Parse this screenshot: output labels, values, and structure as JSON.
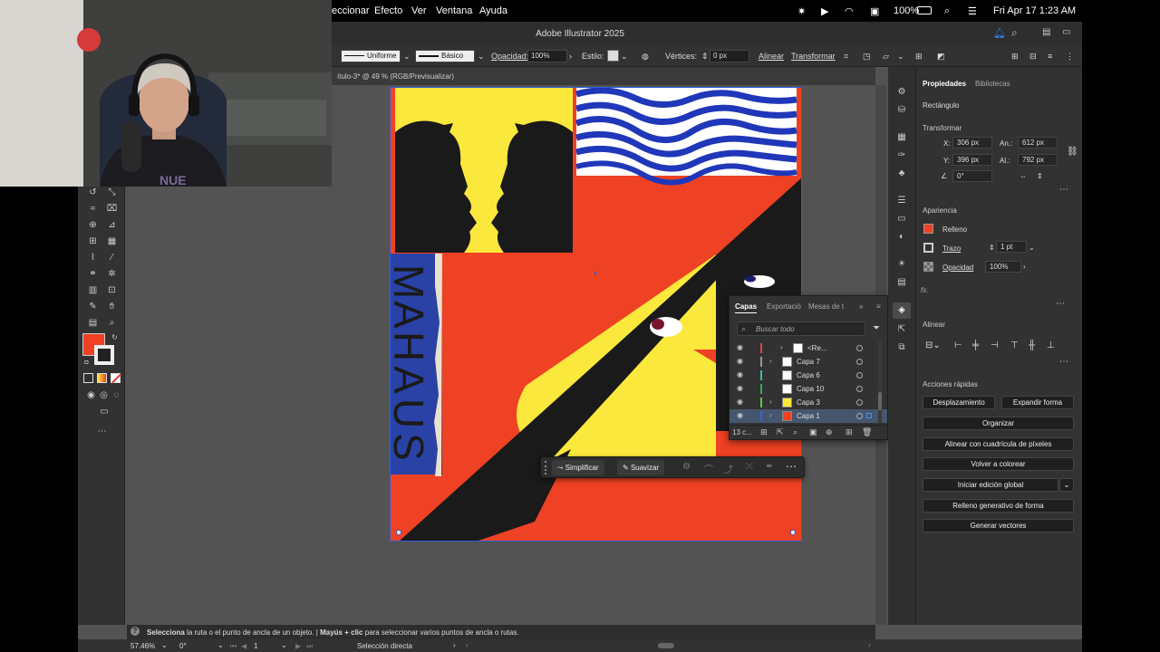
{
  "menubar": {
    "items": [
      "eccionar",
      "Efecto",
      "Ver",
      "Ventana",
      "Ayuda"
    ],
    "battery": "100%",
    "datetime": "Fri Apr 17  1:23 AM"
  },
  "window": {
    "title": "Adobe Illustrator 2025"
  },
  "control_bar": {
    "stroke_style": "Uniforme",
    "brush": "Básico",
    "opacity_label": "Opacidad:",
    "opacity_value": "100%",
    "style_label": "Estilo:",
    "vertices_label": "Vértices:",
    "vertices_value": "0 px",
    "align": "Alinear",
    "transform": "Transformar"
  },
  "doc_tab": {
    "title": "ítulo-3* @ 49 % (RGB/Previsualizar)"
  },
  "fill_color": "#f04124",
  "artwork": {
    "letters": [
      "M",
      "A",
      "H",
      "A",
      "U",
      "S"
    ],
    "colors": {
      "red": "#ef4123",
      "yellow": "#fbe83c",
      "blue": "#2a42a6",
      "black": "#1a1a1a"
    }
  },
  "layers_panel": {
    "tabs": [
      "Capas",
      "Exportació",
      "Mesas de t"
    ],
    "search_placeholder": "Buscar todo",
    "rows": [
      {
        "name": "<Re...",
        "color": "#e84040",
        "thumb": "#ffffff"
      },
      {
        "name": "Capa 7",
        "color": "#999999",
        "thumb": "#ffffff"
      },
      {
        "name": "Capa 6",
        "color": "#33bbaa",
        "thumb": "#ffffff"
      },
      {
        "name": "Capa 10",
        "color": "#33aa55",
        "thumb": "#ffffff"
      },
      {
        "name": "Capa 3",
        "color": "#55cc44",
        "thumb": "#fbe83c"
      },
      {
        "name": "Capa 1",
        "color": "#3366dd",
        "thumb": "#ef4123"
      }
    ],
    "count": "13 c..."
  },
  "float_toolbar": {
    "simplify": "Simplificar",
    "smooth": "Suavizar"
  },
  "properties": {
    "tabs": [
      "Propiedades",
      "Bibliotecas"
    ],
    "object_type": "Rectángulo",
    "transform_heading": "Transformar",
    "x_label": "X:",
    "x_value": "306 px",
    "y_label": "Y:",
    "y_value": "396 px",
    "w_label": "An.:",
    "w_value": "612 px",
    "h_label": "Al.:",
    "h_value": "792 px",
    "angle": "0°",
    "appearance_heading": "Apariencia",
    "fill_label": "Relleno",
    "stroke_label": "Trazo",
    "stroke_value": "1 pt",
    "opacity_label": "Opacidad",
    "opacity_value": "100%",
    "fx": "fx.",
    "align_heading": "Alinear",
    "quick_actions_heading": "Acciones rápidas",
    "buttons": {
      "offset": "Desplazamiento",
      "expand": "Expandir forma",
      "arrange": "Organizar",
      "pixel_grid": "Alinear con cuadrícula de píxeles",
      "recolor": "Volver a colorear",
      "global_edit": "Iniciar edición global",
      "gen_shape_fill": "Relleno generativo de forma",
      "gen_vectors": "Generar vectores"
    }
  },
  "status": {
    "hint_bold1": "Selecciona",
    "hint1": " la ruta o el punto de ancla de un objeto.  |  ",
    "hint_bold2": "Mayús + clic",
    "hint2": " para seleccionar varios puntos de ancla o rutas."
  },
  "bottom": {
    "zoom": "57.46%",
    "rotation": "0°",
    "artboard": "1",
    "tool": "Selección directa"
  }
}
